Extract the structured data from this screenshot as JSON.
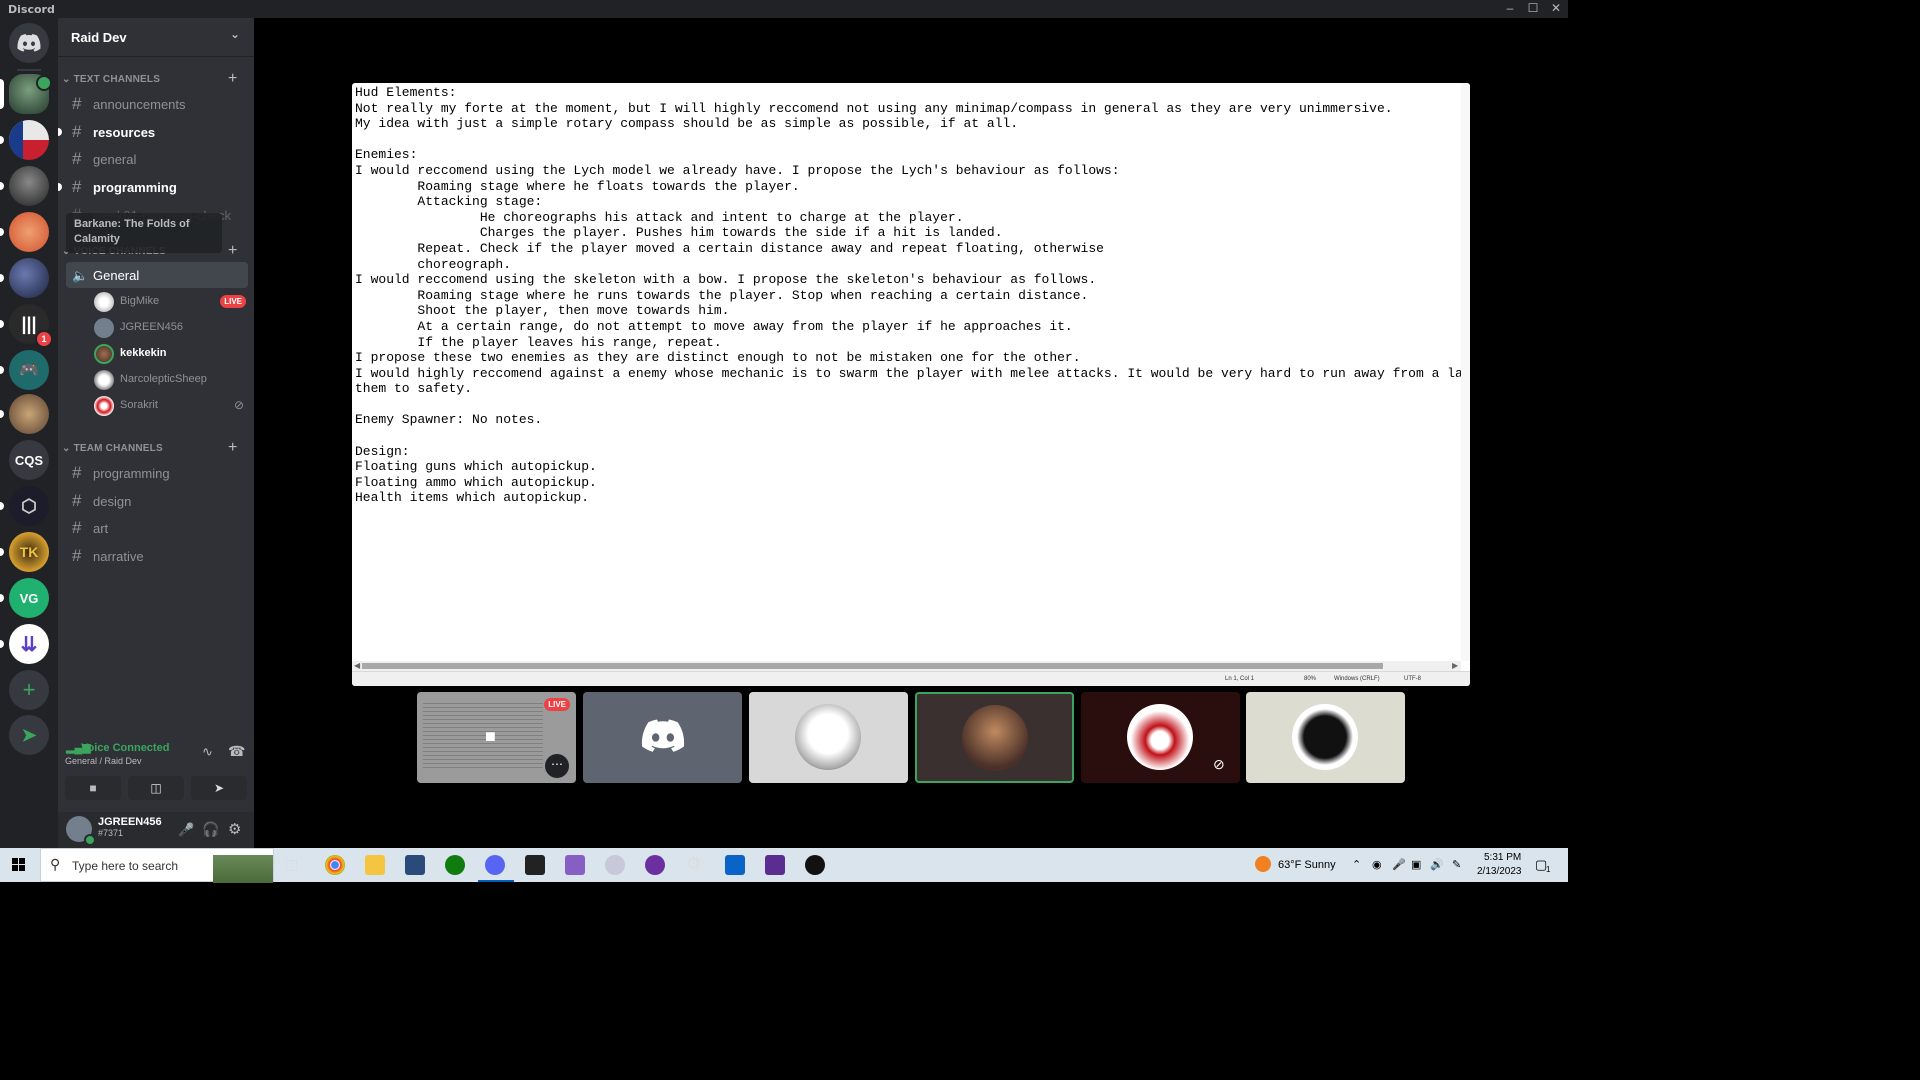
{
  "window": {
    "title": "Discord"
  },
  "servers": [
    {
      "label": "CQS"
    }
  ],
  "server": {
    "name": "Raid Dev"
  },
  "categories": {
    "text": "TEXT CHANNELS",
    "voice": "VOICE CHANNELS",
    "team": "TEAM CHANNELS"
  },
  "text_channels": [
    {
      "label": "announcements"
    },
    {
      "label": "resources"
    },
    {
      "label": "general"
    },
    {
      "label": "programming"
    },
    {
      "label": "week01-progress-check"
    }
  ],
  "tooltip": "Barkane: The Folds of Calamity",
  "voice_channel": {
    "label": "General"
  },
  "voice_users": [
    {
      "name": "BigMike",
      "badge": "LIVE"
    },
    {
      "name": "JGREEN456"
    },
    {
      "name": "kekkekin"
    },
    {
      "name": "NarcolepticSheep"
    },
    {
      "name": "Sorakrit"
    }
  ],
  "team_channels": [
    {
      "label": "programming"
    },
    {
      "label": "design"
    },
    {
      "label": "art"
    },
    {
      "label": "narrative"
    }
  ],
  "voice_panel": {
    "status": "Voice Connected",
    "location": "General / Raid Dev"
  },
  "user": {
    "name": "JGREEN456",
    "tag": "#7371"
  },
  "badges": {
    "unread": "1"
  },
  "stream": {
    "lines": [
      "Hud Elements:",
      "Not really my forte at the moment, but I will highly reccomend not using any minimap/compass in general as they are very unimmersive.",
      "My idea with just a simple rotary compass should be as simple as possible, if at all.",
      "",
      "Enemies:",
      "I would reccomend using the Lych model we already have. I propose the Lych's behaviour as follows:",
      "        Roaming stage where he floats towards the player.",
      "        Attacking stage:",
      "                He choreographs his attack and intent to charge at the player.",
      "                Charges the player. Pushes him towards the side if a hit is landed.",
      "        Repeat. Check if the player moved a certain distance away and repeat floating, otherwise",
      "        choreograph.",
      "I would reccomend using the skeleton with a bow. I propose the skeleton's behaviour as follows.",
      "        Roaming stage where he runs towards the player. Stop when reaching a certain distance.",
      "        Shoot the player, then move towards him.",
      "        At a certain range, do not attempt to move away from the player if he approaches it.",
      "        If the player leaves his range, repeat.",
      "I propose these two enemies as they are distinct enough to not be mistaken one for the other.",
      "I would highly reccomend against a enemy whose mechanic is to swarm the player with melee attacks. It would be very hard to run away from a large",
      "them to safety.",
      "",
      "Enemy Spawner: No notes.",
      "",
      "Design:",
      "Floating guns which autopickup.",
      "Floating ammo which autopickup.",
      "Health items which autopickup."
    ],
    "status": {
      "position": "Ln 1, Col 1",
      "zoom": "80%",
      "eol": "Windows (CRLF)",
      "encoding": "UTF-8"
    }
  },
  "tiles": {
    "live": "LIVE"
  },
  "taskbar": {
    "search_placeholder": "Type here to search",
    "weather": "63°F  Sunny",
    "time": "5:31 PM",
    "date": "2/13/2023",
    "notifications": "1"
  },
  "colors": {
    "accent": "#5865f2",
    "online": "#3ba55d",
    "live": "#ed4245"
  }
}
